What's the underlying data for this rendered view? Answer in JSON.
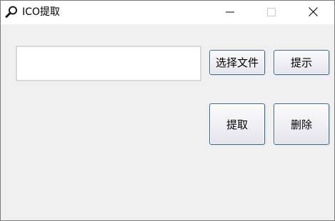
{
  "window": {
    "title": "ICO提取",
    "title_icon": "magnifier-icon",
    "controls": {
      "minimize_icon": "minimize-icon",
      "maximize_icon": "maximize-icon",
      "close_icon": "close-icon"
    }
  },
  "form": {
    "path_value": "",
    "path_placeholder": ""
  },
  "buttons": {
    "choose_file": "选择文件",
    "hint": "提示",
    "extract": "提取",
    "delete": "删除"
  },
  "colors": {
    "button_border": "#3a6a9a",
    "window_background": "#f0f0f0",
    "titlebar_background": "#ffffff"
  }
}
